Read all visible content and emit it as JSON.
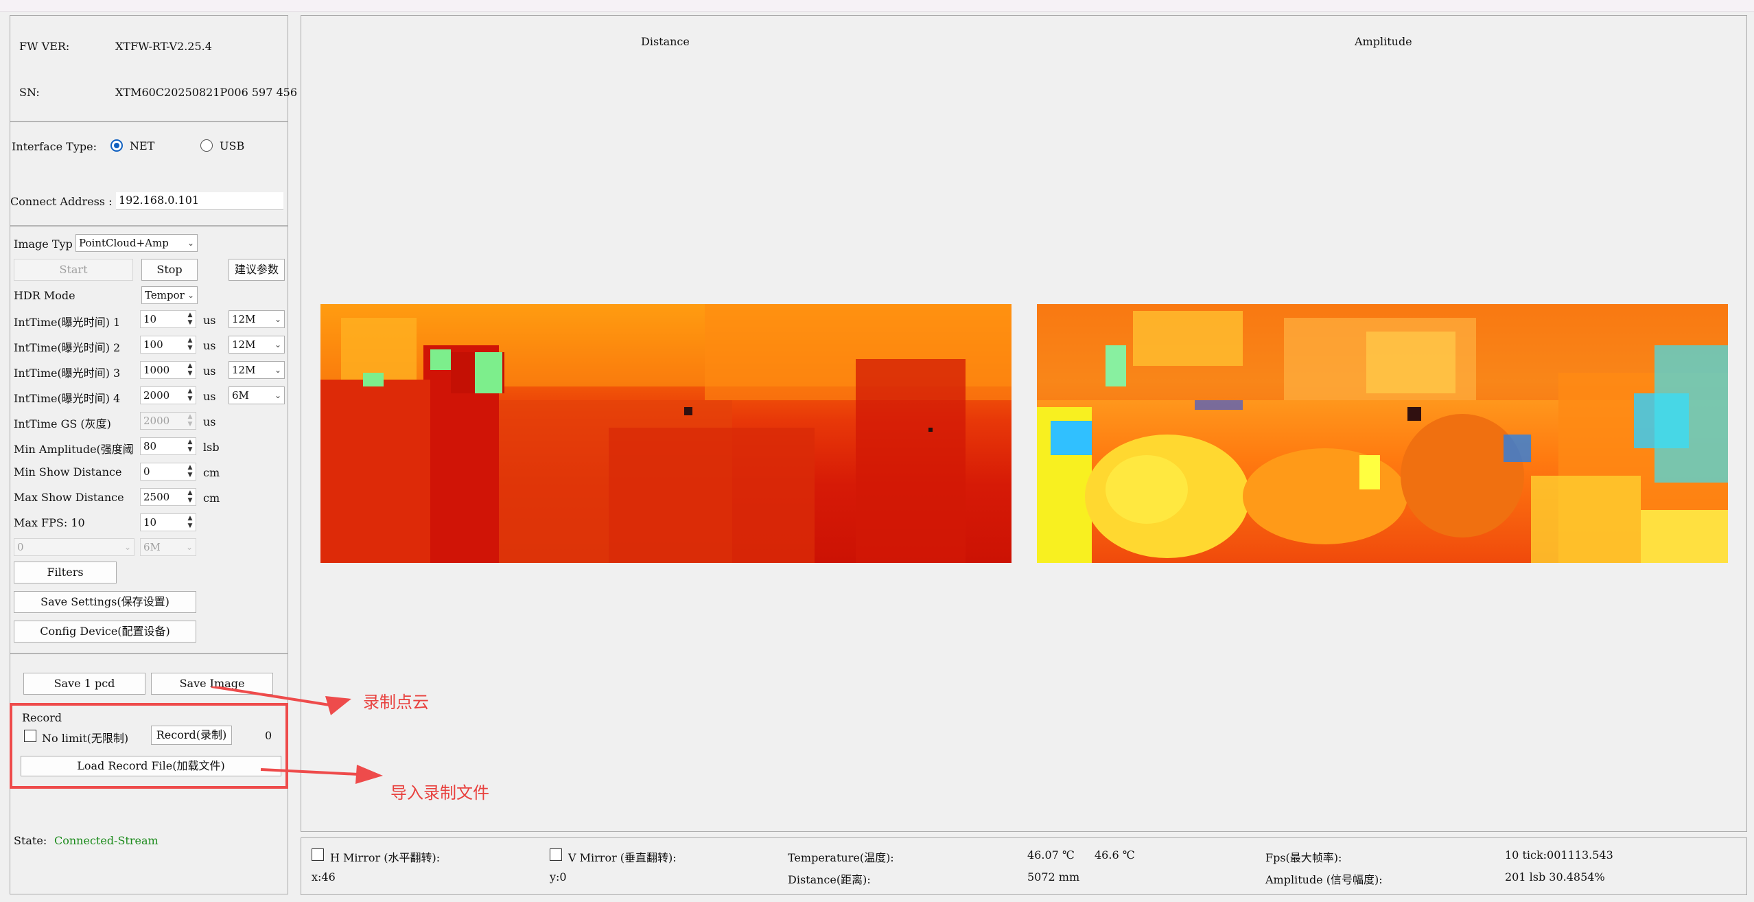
{
  "device": {
    "fw_label": "FW VER:",
    "fw_value": "XTFW-RT-V2.25.4",
    "sn_label": "SN:",
    "sn_value": "XTM60C20250821P006 597 456"
  },
  "interface": {
    "label": "Interface Type:",
    "net": "NET",
    "usb": "USB",
    "selected": "NET",
    "addr_label": "Connect Address :",
    "addr_value": "192.168.0.101"
  },
  "controls": {
    "image_type_label": "Image Typ‑",
    "image_type_value": "PointCloud+Amp",
    "start": "Start",
    "stop": "Stop",
    "suggest": "建议参数",
    "hdr_label": "HDR Mode",
    "hdr_value": "Tempor",
    "int_rows": [
      {
        "label": "IntTime(曝光时间) 1",
        "value": "10",
        "unit": "us",
        "freq": "12M"
      },
      {
        "label": "IntTime(曝光时间) 2",
        "value": "100",
        "unit": "us",
        "freq": "12M"
      },
      {
        "label": "IntTime(曝光时间) 3",
        "value": "1000",
        "unit": "us",
        "freq": "12M"
      },
      {
        "label": "IntTime(曝光时间) 4",
        "value": "2000",
        "unit": "us",
        "freq": "6M"
      }
    ],
    "gs_label": "IntTime GS (灰度)",
    "gs_value": "2000",
    "gs_unit": "us",
    "min_amp_label": "Min Amplitude(强度阈",
    "min_amp_value": "80",
    "min_amp_unit": "lsb",
    "min_dist_label": "Min Show Distance",
    "min_dist_value": "0",
    "min_dist_unit": "cm",
    "max_dist_label": "Max Show Distance",
    "max_dist_value": "2500",
    "max_dist_unit": "cm",
    "max_fps_label": "Max FPS: 10",
    "max_fps_value": "10",
    "extra_select_1": "0",
    "extra_select_2": "6M",
    "filters": "Filters",
    "save_settings": "Save Settings(保存设置)",
    "config_device": "Config Device(配置设备)"
  },
  "record": {
    "save_pcd": "Save 1 pcd",
    "save_image": "Save Image",
    "group_label": "Record",
    "no_limit": "No limit(无限制)",
    "record_btn": "Record(录制)",
    "count": "0",
    "load_file": "Load Record File(加载文件)"
  },
  "state": {
    "label": "State:",
    "value": "Connected-Stream",
    "value_color": "#1a8a1a"
  },
  "views": {
    "distance_title": "Distance",
    "amplitude_title": "Amplitude"
  },
  "status_bar": {
    "h_mirror": "H Mirror (水平翻转):",
    "v_mirror": "V Mirror (垂直翻转):",
    "temp_label": "Temperature(温度):",
    "temp_value_1": "46.07 ℃",
    "temp_value_2": "46.6 ℃",
    "fps_label": "Fps(最大帧率):",
    "fps_value": "10 tick:001113.543",
    "x_value": "x:46",
    "y_value": "y:0",
    "dist_label": "Distance(距离):",
    "dist_value": "5072 mm",
    "amp_label": "Amplitude (信号幅度):",
    "amp_value": "201 lsb  30.4854%"
  },
  "annotations": {
    "record_note": "录制点云",
    "load_note": "导入录制文件",
    "color": "#e8413e"
  }
}
